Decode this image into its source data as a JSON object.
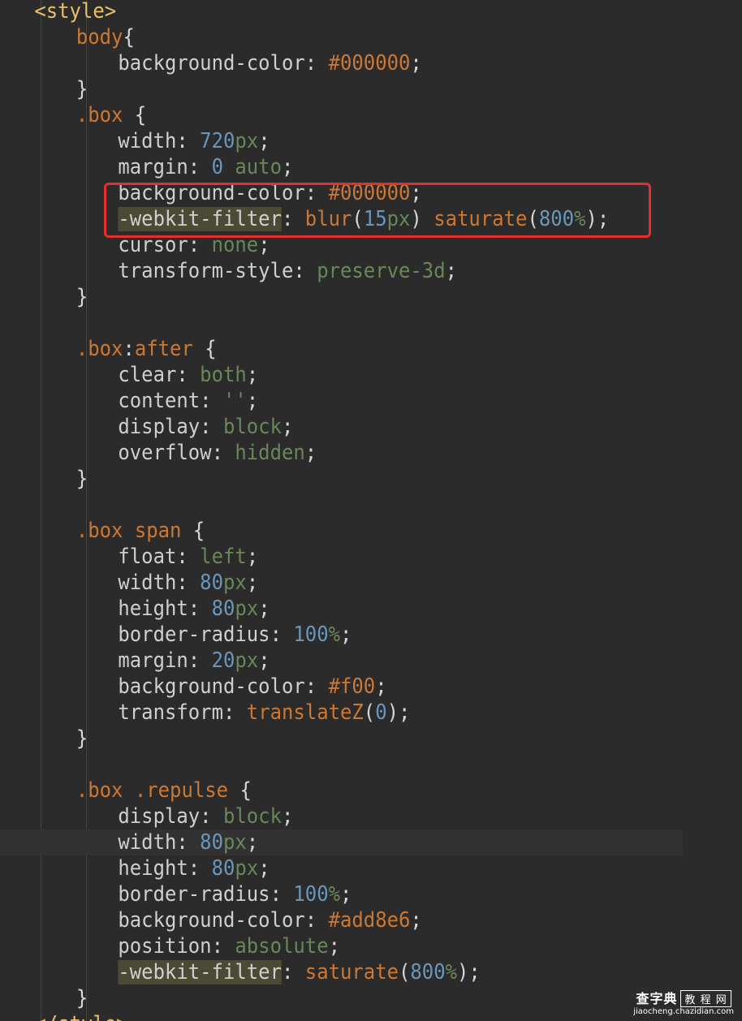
{
  "editor": {
    "language": "css",
    "current_line_index": 32,
    "highlight": {
      "color": "#e62e2e",
      "lines": [
        7,
        8
      ]
    },
    "lines": [
      {
        "indent": 0,
        "tokens": [
          {
            "t": "<style>",
            "k": "tag"
          }
        ]
      },
      {
        "indent": 1,
        "tokens": [
          {
            "t": "body",
            "k": "sel"
          },
          {
            "t": "{",
            "k": "punct"
          }
        ]
      },
      {
        "indent": 2,
        "tokens": [
          {
            "t": "background-color",
            "k": "prop"
          },
          {
            "t": ": ",
            "k": "punct"
          },
          {
            "t": "#000000",
            "k": "hex"
          },
          {
            "t": ";",
            "k": "punct"
          }
        ]
      },
      {
        "indent": 1,
        "tokens": [
          {
            "t": "}",
            "k": "punct"
          }
        ]
      },
      {
        "indent": 1,
        "tokens": [
          {
            "t": ".box",
            "k": "sel"
          },
          {
            "t": " {",
            "k": "punct"
          }
        ]
      },
      {
        "indent": 2,
        "tokens": [
          {
            "t": "width",
            "k": "prop"
          },
          {
            "t": ": ",
            "k": "punct"
          },
          {
            "t": "720",
            "k": "num"
          },
          {
            "t": "px",
            "k": "kw"
          },
          {
            "t": ";",
            "k": "punct"
          }
        ]
      },
      {
        "indent": 2,
        "tokens": [
          {
            "t": "margin",
            "k": "prop"
          },
          {
            "t": ": ",
            "k": "punct"
          },
          {
            "t": "0",
            "k": "num"
          },
          {
            "t": " ",
            "k": "punct"
          },
          {
            "t": "auto",
            "k": "kw"
          },
          {
            "t": ";",
            "k": "punct"
          }
        ]
      },
      {
        "indent": 2,
        "tokens": [
          {
            "t": "background-color",
            "k": "prop"
          },
          {
            "t": ": ",
            "k": "punct"
          },
          {
            "t": "#000000",
            "k": "hex"
          },
          {
            "t": ";",
            "k": "punct"
          }
        ]
      },
      {
        "indent": 2,
        "tokens": [
          {
            "t": "-webkit-filter",
            "k": "prop-hl"
          },
          {
            "t": ": ",
            "k": "punct"
          },
          {
            "t": "blur",
            "k": "fn"
          },
          {
            "t": "(",
            "k": "punct"
          },
          {
            "t": "15",
            "k": "num"
          },
          {
            "t": "px",
            "k": "kw"
          },
          {
            "t": ") ",
            "k": "punct"
          },
          {
            "t": "saturate",
            "k": "fn"
          },
          {
            "t": "(",
            "k": "punct"
          },
          {
            "t": "800",
            "k": "num"
          },
          {
            "t": "%",
            "k": "kw"
          },
          {
            "t": ");",
            "k": "punct"
          }
        ]
      },
      {
        "indent": 2,
        "tokens": [
          {
            "t": "cursor",
            "k": "prop"
          },
          {
            "t": ": ",
            "k": "punct"
          },
          {
            "t": "none",
            "k": "kw"
          },
          {
            "t": ";",
            "k": "punct"
          }
        ]
      },
      {
        "indent": 2,
        "tokens": [
          {
            "t": "transform-style",
            "k": "prop"
          },
          {
            "t": ": ",
            "k": "punct"
          },
          {
            "t": "preserve-3d",
            "k": "kw"
          },
          {
            "t": ";",
            "k": "punct"
          }
        ]
      },
      {
        "indent": 1,
        "tokens": [
          {
            "t": "}",
            "k": "punct"
          }
        ]
      },
      {
        "indent": 0,
        "tokens": []
      },
      {
        "indent": 1,
        "tokens": [
          {
            "t": ".box",
            "k": "sel"
          },
          {
            "t": ":",
            "k": "punct"
          },
          {
            "t": "after",
            "k": "sel"
          },
          {
            "t": " {",
            "k": "punct"
          }
        ]
      },
      {
        "indent": 2,
        "tokens": [
          {
            "t": "clear",
            "k": "prop"
          },
          {
            "t": ": ",
            "k": "punct"
          },
          {
            "t": "both",
            "k": "kw"
          },
          {
            "t": ";",
            "k": "punct"
          }
        ]
      },
      {
        "indent": 2,
        "tokens": [
          {
            "t": "content",
            "k": "prop"
          },
          {
            "t": ": ",
            "k": "punct"
          },
          {
            "t": "''",
            "k": "kw"
          },
          {
            "t": ";",
            "k": "punct"
          }
        ]
      },
      {
        "indent": 2,
        "tokens": [
          {
            "t": "display",
            "k": "prop"
          },
          {
            "t": ": ",
            "k": "punct"
          },
          {
            "t": "block",
            "k": "kw"
          },
          {
            "t": ";",
            "k": "punct"
          }
        ]
      },
      {
        "indent": 2,
        "tokens": [
          {
            "t": "overflow",
            "k": "prop"
          },
          {
            "t": ": ",
            "k": "punct"
          },
          {
            "t": "hidden",
            "k": "kw"
          },
          {
            "t": ";",
            "k": "punct"
          }
        ]
      },
      {
        "indent": 1,
        "tokens": [
          {
            "t": "}",
            "k": "punct"
          }
        ]
      },
      {
        "indent": 0,
        "tokens": []
      },
      {
        "indent": 1,
        "tokens": [
          {
            "t": ".box",
            "k": "sel"
          },
          {
            "t": " ",
            "k": "punct"
          },
          {
            "t": "span",
            "k": "sel"
          },
          {
            "t": " {",
            "k": "punct"
          }
        ]
      },
      {
        "indent": 2,
        "tokens": [
          {
            "t": "float",
            "k": "prop"
          },
          {
            "t": ": ",
            "k": "punct"
          },
          {
            "t": "left",
            "k": "kw"
          },
          {
            "t": ";",
            "k": "punct"
          }
        ]
      },
      {
        "indent": 2,
        "tokens": [
          {
            "t": "width",
            "k": "prop"
          },
          {
            "t": ": ",
            "k": "punct"
          },
          {
            "t": "80",
            "k": "num"
          },
          {
            "t": "px",
            "k": "kw"
          },
          {
            "t": ";",
            "k": "punct"
          }
        ]
      },
      {
        "indent": 2,
        "tokens": [
          {
            "t": "height",
            "k": "prop"
          },
          {
            "t": ": ",
            "k": "punct"
          },
          {
            "t": "80",
            "k": "num"
          },
          {
            "t": "px",
            "k": "kw"
          },
          {
            "t": ";",
            "k": "punct"
          }
        ]
      },
      {
        "indent": 2,
        "tokens": [
          {
            "t": "border-radius",
            "k": "prop"
          },
          {
            "t": ": ",
            "k": "punct"
          },
          {
            "t": "100",
            "k": "num"
          },
          {
            "t": "%",
            "k": "kw"
          },
          {
            "t": ";",
            "k": "punct"
          }
        ]
      },
      {
        "indent": 2,
        "tokens": [
          {
            "t": "margin",
            "k": "prop"
          },
          {
            "t": ": ",
            "k": "punct"
          },
          {
            "t": "20",
            "k": "num"
          },
          {
            "t": "px",
            "k": "kw"
          },
          {
            "t": ";",
            "k": "punct"
          }
        ]
      },
      {
        "indent": 2,
        "tokens": [
          {
            "t": "background-color",
            "k": "prop"
          },
          {
            "t": ": ",
            "k": "punct"
          },
          {
            "t": "#f00",
            "k": "hex"
          },
          {
            "t": ";",
            "k": "punct"
          }
        ]
      },
      {
        "indent": 2,
        "tokens": [
          {
            "t": "transform",
            "k": "prop"
          },
          {
            "t": ": ",
            "k": "punct"
          },
          {
            "t": "translateZ",
            "k": "fn"
          },
          {
            "t": "(",
            "k": "punct"
          },
          {
            "t": "0",
            "k": "num"
          },
          {
            "t": ");",
            "k": "punct"
          }
        ]
      },
      {
        "indent": 1,
        "tokens": [
          {
            "t": "}",
            "k": "punct"
          }
        ]
      },
      {
        "indent": 0,
        "tokens": []
      },
      {
        "indent": 1,
        "tokens": [
          {
            "t": ".box",
            "k": "sel"
          },
          {
            "t": " ",
            "k": "punct"
          },
          {
            "t": ".repulse",
            "k": "sel"
          },
          {
            "t": " {",
            "k": "punct"
          }
        ]
      },
      {
        "indent": 2,
        "tokens": [
          {
            "t": "display",
            "k": "prop"
          },
          {
            "t": ": ",
            "k": "punct"
          },
          {
            "t": "block",
            "k": "kw"
          },
          {
            "t": ";",
            "k": "punct"
          }
        ]
      },
      {
        "indent": 2,
        "tokens": [
          {
            "t": "width",
            "k": "prop"
          },
          {
            "t": ": ",
            "k": "punct"
          },
          {
            "t": "80",
            "k": "num"
          },
          {
            "t": "px",
            "k": "kw"
          },
          {
            "t": ";",
            "k": "punct"
          }
        ]
      },
      {
        "indent": 2,
        "tokens": [
          {
            "t": "height",
            "k": "prop"
          },
          {
            "t": ": ",
            "k": "punct"
          },
          {
            "t": "80",
            "k": "num"
          },
          {
            "t": "px",
            "k": "kw"
          },
          {
            "t": ";",
            "k": "punct"
          }
        ]
      },
      {
        "indent": 2,
        "tokens": [
          {
            "t": "border-radius",
            "k": "prop"
          },
          {
            "t": ": ",
            "k": "punct"
          },
          {
            "t": "100",
            "k": "num"
          },
          {
            "t": "%",
            "k": "kw"
          },
          {
            "t": ";",
            "k": "punct"
          }
        ]
      },
      {
        "indent": 2,
        "tokens": [
          {
            "t": "background-color",
            "k": "prop"
          },
          {
            "t": ": ",
            "k": "punct"
          },
          {
            "t": "#add8e6",
            "k": "hex"
          },
          {
            "t": ";",
            "k": "punct"
          }
        ]
      },
      {
        "indent": 2,
        "tokens": [
          {
            "t": "position",
            "k": "prop"
          },
          {
            "t": ": ",
            "k": "punct"
          },
          {
            "t": "absolute",
            "k": "kw"
          },
          {
            "t": ";",
            "k": "punct"
          }
        ]
      },
      {
        "indent": 2,
        "tokens": [
          {
            "t": "-webkit-filter",
            "k": "prop-hl"
          },
          {
            "t": ": ",
            "k": "punct"
          },
          {
            "t": "saturate",
            "k": "fn"
          },
          {
            "t": "(",
            "k": "punct"
          },
          {
            "t": "800",
            "k": "num"
          },
          {
            "t": "%",
            "k": "kw"
          },
          {
            "t": ");",
            "k": "punct"
          }
        ]
      },
      {
        "indent": 1,
        "tokens": [
          {
            "t": "}",
            "k": "punct"
          }
        ]
      },
      {
        "indent": 0,
        "tokens": [
          {
            "t": "</style>",
            "k": "tag"
          }
        ]
      }
    ]
  },
  "watermark": {
    "brand": "查字典",
    "tag": "教 程 网",
    "url": "jiaocheng.chazidian.com"
  }
}
